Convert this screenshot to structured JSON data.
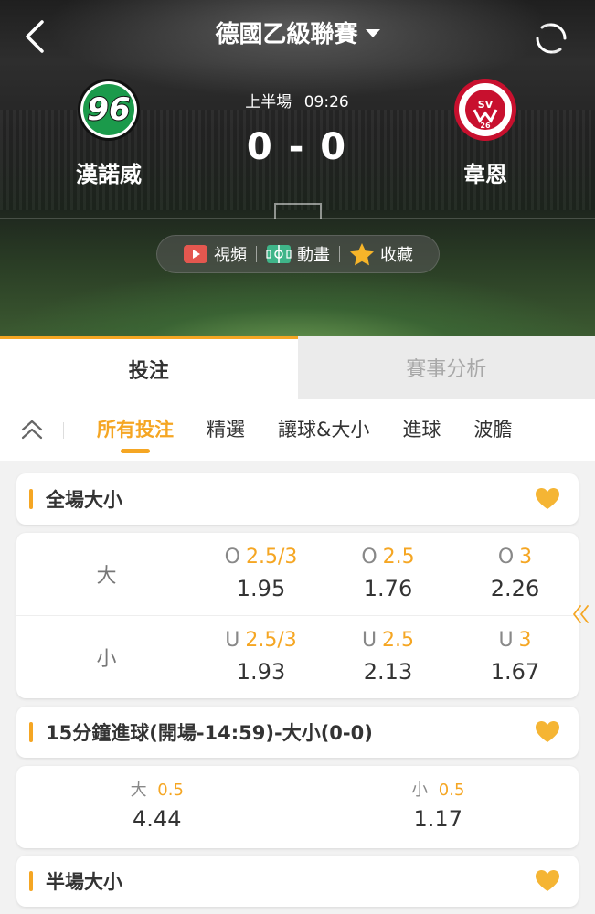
{
  "header": {
    "league_title": "德國乙級聯賽",
    "period": "上半場",
    "match_time": "09:26",
    "home_score": "0",
    "score_sep": "-",
    "away_score": "0"
  },
  "teams": {
    "home": {
      "name": "漢諾威",
      "logo_text": "96"
    },
    "away": {
      "name": "韋恩",
      "logo_text": "SV 26",
      "logo_ring": "SV WEHEN WIESBADEN"
    }
  },
  "media_bar": {
    "video": "視頻",
    "animation": "動畫",
    "favorite": "收藏"
  },
  "main_tabs": [
    "投注",
    "賽事分析"
  ],
  "sub_tabs": [
    "所有投注",
    "精選",
    "讓球&大小",
    "進球",
    "波膽"
  ],
  "markets": [
    {
      "title": "全場大小",
      "rows": [
        {
          "label": "大",
          "cells": [
            {
              "ou": "O",
              "line": "2.5/3",
              "price": "1.95"
            },
            {
              "ou": "O",
              "line": "2.5",
              "price": "1.76"
            },
            {
              "ou": "O",
              "line": "3",
              "price": "2.26"
            }
          ]
        },
        {
          "label": "小",
          "cells": [
            {
              "ou": "U",
              "line": "2.5/3",
              "price": "1.93"
            },
            {
              "ou": "U",
              "line": "2.5",
              "price": "2.13"
            },
            {
              "ou": "U",
              "line": "3",
              "price": "1.67"
            }
          ]
        }
      ]
    },
    {
      "title": "15分鐘進球(開場-14:59)-大小(0-0)",
      "cells": [
        {
          "ou": "大",
          "line": "0.5",
          "price": "4.44"
        },
        {
          "ou": "小",
          "line": "0.5",
          "price": "1.17"
        }
      ]
    },
    {
      "title": "半場大小"
    }
  ],
  "colors": {
    "accent": "#f5a623",
    "text": "#333333",
    "muted": "#888888",
    "background": "#f2f2f2"
  },
  "icons": {
    "back": "chevron-left-icon",
    "refresh": "refresh-icon",
    "dropdown": "caret-down-icon",
    "video": "video-play-icon",
    "animation": "pitch-animation-icon",
    "favorite": "star-icon",
    "collapse": "double-chevron-up-icon",
    "market_favorite": "heart-icon",
    "scroll_more": "double-chevron-left-icon"
  }
}
